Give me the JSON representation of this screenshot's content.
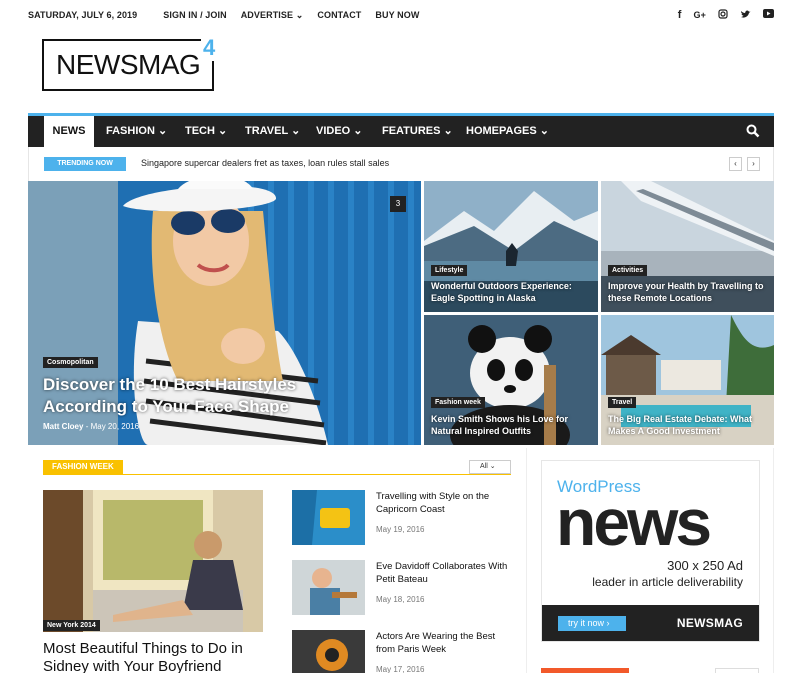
{
  "topbar": {
    "date": "SATURDAY, JULY 6, 2019",
    "links": [
      "SIGN IN / JOIN",
      "ADVERTISE",
      "CONTACT",
      "BUY NOW"
    ],
    "advertise_dropdown": "⌄",
    "social": [
      "facebook-icon",
      "google-plus-icon",
      "instagram-icon",
      "twitter-icon",
      "youtube-icon"
    ]
  },
  "logo": {
    "text": "NEWSMAG",
    "version": "4"
  },
  "nav": {
    "items": [
      "NEWS",
      "FASHION",
      "TECH",
      "TRAVEL",
      "VIDEO",
      "FEATURES",
      "HOMEPAGES"
    ],
    "chevron": "⌄"
  },
  "trending": {
    "label": "TRENDING NOW",
    "headline": "Singapore supercar dealers fret as taxes, loan rules stall sales",
    "prev": "‹",
    "next": "›"
  },
  "featured": {
    "big": {
      "category": "Cosmopolitan",
      "title": "Discover the 10 Best Hairstyles According to Your Face Shape",
      "author": "Matt Cloey",
      "separator": "-",
      "date": "May 20, 2016",
      "comments": "3"
    },
    "tiles": [
      {
        "category": "Lifestyle",
        "title": "Wonderful Outdoors Experience: Eagle Spotting in Alaska"
      },
      {
        "category": "Activities",
        "title": "Improve your Health by Travelling to these Remote Locations"
      },
      {
        "category": "Fashion week",
        "title": "Kevin Smith Shows his Love for Natural Inspired Outfits"
      },
      {
        "category": "Travel",
        "title": "The Big Real Estate Debate: What Makes A Good Investment"
      }
    ]
  },
  "block": {
    "heading": "FASHION WEEK",
    "filter": "All",
    "main": {
      "category": "New York 2014",
      "title": "Most Beautiful Things to Do in Sidney with Your Boyfriend"
    },
    "list": [
      {
        "title": "Travelling with Style on the Capricorn Coast",
        "date": "May 19, 2016"
      },
      {
        "title": "Eve Davidoff Collaborates With Petit Bateau",
        "date": "May 18, 2016"
      },
      {
        "title": "Actors Are Wearing the Best from Paris Week",
        "date": "May 17, 2016"
      }
    ]
  },
  "ad": {
    "wordpress": "WordPress",
    "news": "news",
    "size": "300 x 250 Ad",
    "tagline": "leader in article deliverability",
    "cta": "try it now ›",
    "brand": "NEWSMAG"
  },
  "colors": {
    "accent": "#4db2ec",
    "nav_bg": "#222222",
    "fashion": "#f9c100"
  }
}
